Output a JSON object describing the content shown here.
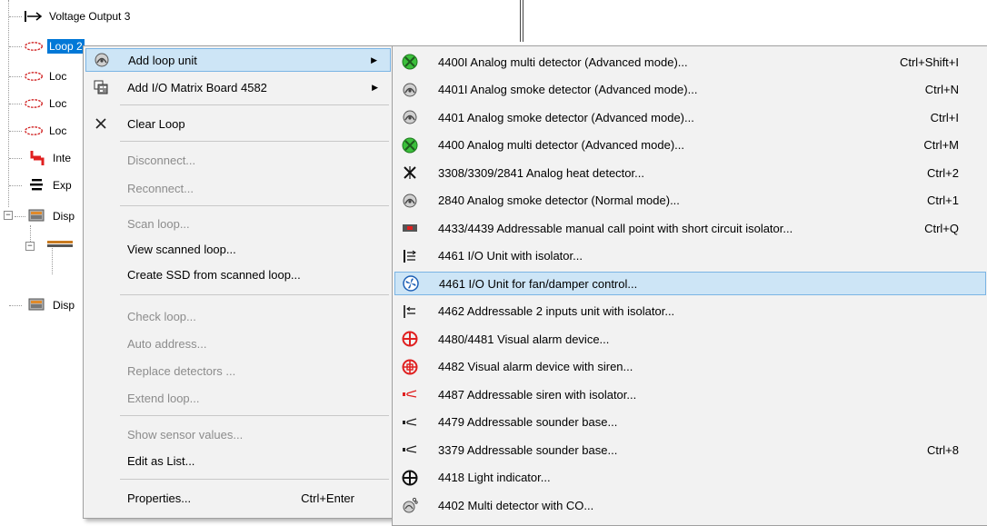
{
  "tree": {
    "items": [
      {
        "label": "Voltage Output 3",
        "icon": "arrow-right-icon"
      },
      {
        "label": "Loop 2",
        "icon": "loop-icon",
        "selected": true
      },
      {
        "label": "Loc",
        "icon": "loop-icon"
      },
      {
        "label": "Loc",
        "icon": "loop-icon"
      },
      {
        "label": "Loc",
        "icon": "loop-icon"
      },
      {
        "label": "Inte",
        "icon": "interface-icon"
      },
      {
        "label": "Exp",
        "icon": "expansion-icon"
      },
      {
        "label": "Disp",
        "icon": "display-icon"
      },
      {
        "label": "Disp",
        "icon": "display-icon"
      }
    ]
  },
  "context_menu": {
    "add_loop_unit": "Add loop unit",
    "add_io_matrix": "Add I/O Matrix Board 4582",
    "clear_loop": "Clear Loop",
    "disconnect": "Disconnect...",
    "reconnect": "Reconnect...",
    "scan_loop": "Scan loop...",
    "view_scanned_loop": "View scanned loop...",
    "create_ssd": "Create SSD from scanned loop...",
    "check_loop": "Check loop...",
    "auto_address": "Auto address...",
    "replace_detectors": "Replace detectors ...",
    "extend_loop": "Extend loop...",
    "show_sensor_values": "Show sensor values...",
    "edit_as_list": "Edit as List...",
    "properties": "Properties...",
    "properties_shortcut": "Ctrl+Enter"
  },
  "submenu": {
    "items": [
      {
        "label": "4400I Analog multi detector (Advanced mode)...",
        "shortcut": "Ctrl+Shift+I",
        "icon": "multi-detector-icon"
      },
      {
        "label": "4401I Analog smoke detector (Advanced mode)...",
        "shortcut": "Ctrl+N",
        "icon": "smoke-detector-icon"
      },
      {
        "label": "4401 Analog smoke detector (Advanced mode)...",
        "shortcut": "Ctrl+I",
        "icon": "smoke-detector-icon"
      },
      {
        "label": "4400 Analog multi detector (Advanced mode)...",
        "shortcut": "Ctrl+M",
        "icon": "multi-detector-icon"
      },
      {
        "label": "3308/3309/2841 Analog heat detector...",
        "shortcut": "Ctrl+2",
        "icon": "heat-detector-icon"
      },
      {
        "label": "2840 Analog smoke detector (Normal mode)...",
        "shortcut": "Ctrl+1",
        "icon": "smoke-detector-icon"
      },
      {
        "label": "4433/4439 Addressable manual call point with short circuit isolator...",
        "shortcut": "Ctrl+Q",
        "icon": "call-point-icon"
      },
      {
        "label": "4461 I/O Unit with isolator...",
        "shortcut": "",
        "icon": "io-unit-icon"
      },
      {
        "label": "4461 I/O Unit for fan/damper control...",
        "shortcut": "",
        "icon": "fan-icon"
      },
      {
        "label": "4462 Addressable 2 inputs unit with isolator...",
        "shortcut": "",
        "icon": "input-unit-icon"
      },
      {
        "label": "4480/4481 Visual alarm device...",
        "shortcut": "",
        "icon": "visual-alarm-icon"
      },
      {
        "label": "4482 Visual alarm device with siren...",
        "shortcut": "",
        "icon": "visual-alarm-siren-icon"
      },
      {
        "label": "4487 Addressable siren with isolator...",
        "shortcut": "",
        "icon": "siren-icon"
      },
      {
        "label": "4479 Addressable sounder base...",
        "shortcut": "",
        "icon": "sounder-icon"
      },
      {
        "label": "3379 Addressable sounder base...",
        "shortcut": "Ctrl+8",
        "icon": "sounder-icon"
      },
      {
        "label": "4418 Light indicator...",
        "shortcut": "",
        "icon": "light-indicator-icon"
      },
      {
        "label": "4402 Multi detector with CO...",
        "shortcut": "",
        "icon": "co-detector-icon"
      }
    ]
  },
  "colors": {
    "selection": "#0078d7",
    "menu_highlight": "#cde5f6",
    "menu_highlight_border": "#7ab4e4",
    "detector_green": "#3bbf3b",
    "alarm_red": "#e02020"
  }
}
